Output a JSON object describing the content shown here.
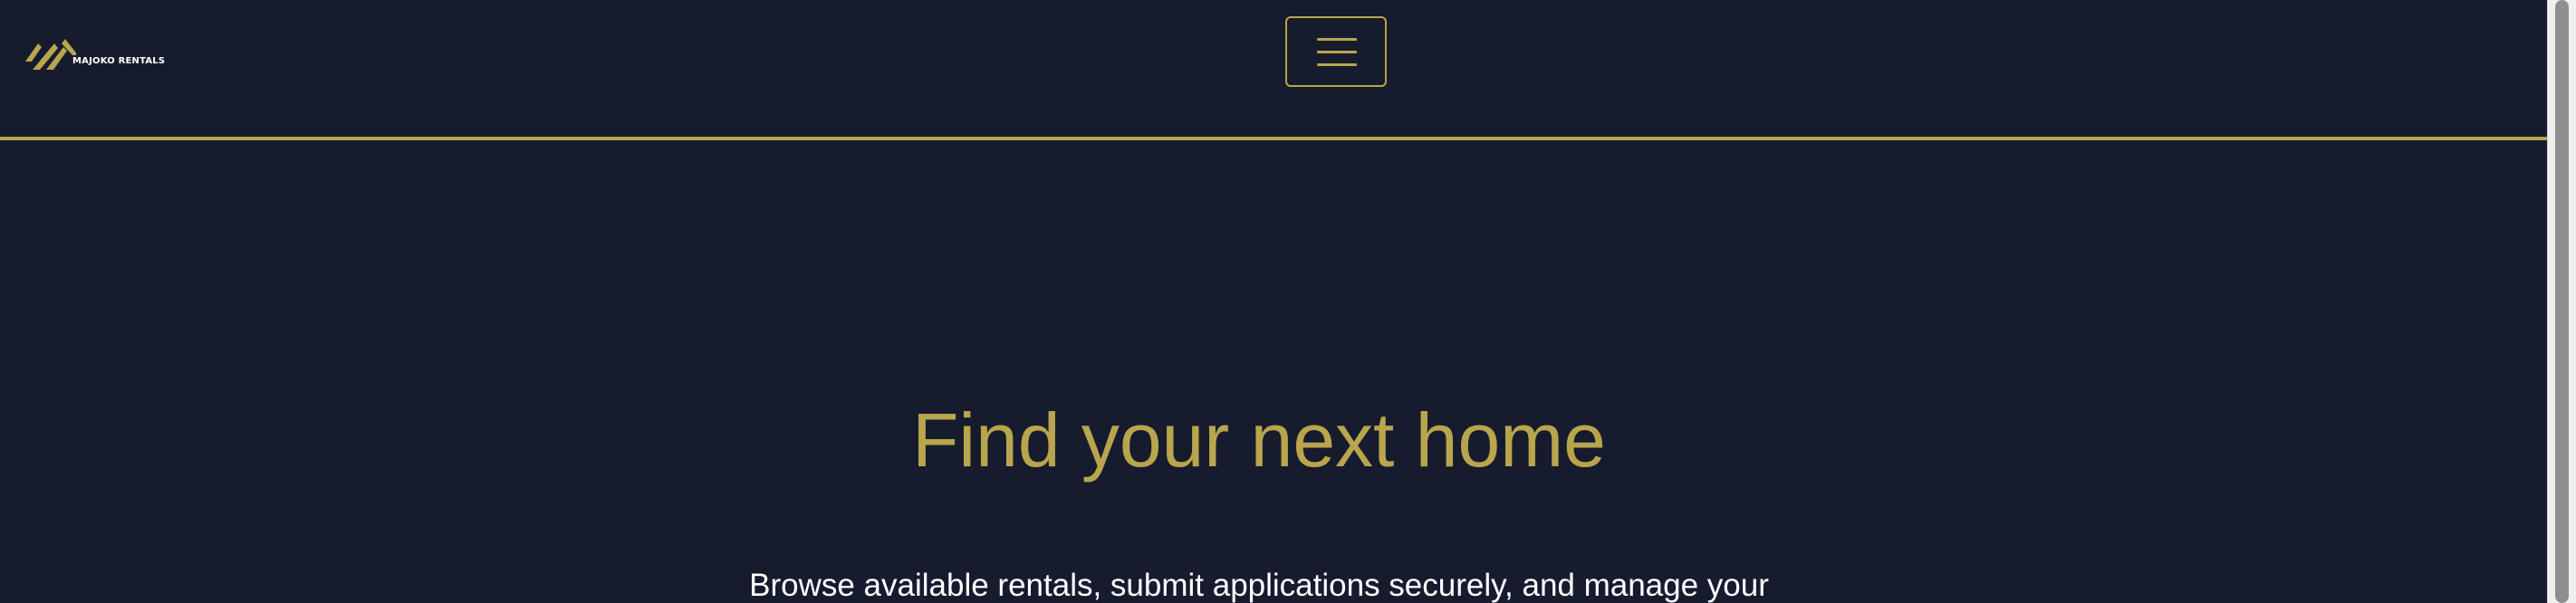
{
  "brand": {
    "name": "MAJOKO RENTALS",
    "accent_color": "#b8a54c",
    "background_color": "#161b2e"
  },
  "navbar": {
    "menu_icon": "hamburger-menu-icon"
  },
  "hero": {
    "title": "Find your next home",
    "subtitle": "Browse available rentals, submit applications securely, and manage your"
  }
}
